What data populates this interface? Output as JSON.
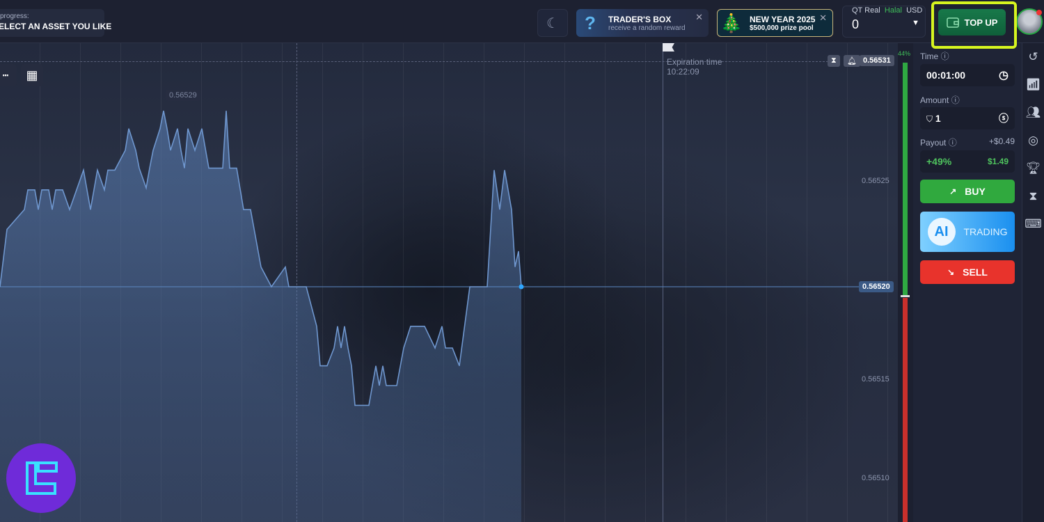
{
  "header": {
    "progress_label": "progress:",
    "progress_task": "ELECT AN ASSET YOU LIKE",
    "traders_box": {
      "title": "TRADER'S BOX",
      "subtitle": "receive a random reward"
    },
    "new_year": {
      "title": "NEW YEAR 2025",
      "subtitle": "$500,000 prize pool"
    },
    "account": {
      "type": "QT Real",
      "tag": "Halal",
      "currency": "USD",
      "balance": "0"
    },
    "topup_label": "TOP UP",
    "colors": {
      "accent_green": "#16713f",
      "highlight": "#d7f51f"
    }
  },
  "chart": {
    "expiration_label": "Expiration time",
    "expiration_time": "10:22:09",
    "current_price": "0.56520",
    "high_price_label": "0.56529",
    "alert_price": "0.56531",
    "y_ticks": [
      "0.56525",
      "0.56520",
      "0.56515",
      "0.56510"
    ],
    "buy_percent": "44%",
    "price_line": {
      "color": "#6f97cf",
      "points": [
        [
          0,
          0.5652
        ],
        [
          2,
          0.565229
        ],
        [
          7,
          0.565239
        ],
        [
          8,
          0.565249
        ],
        [
          10,
          0.565249
        ],
        [
          11,
          0.565239
        ],
        [
          12,
          0.565249
        ],
        [
          14,
          0.565249
        ],
        [
          15,
          0.565239
        ],
        [
          16,
          0.565249
        ],
        [
          18,
          0.565249
        ],
        [
          20,
          0.565239
        ],
        [
          22,
          0.565249
        ],
        [
          24,
          0.565259
        ],
        [
          26,
          0.565239
        ],
        [
          28,
          0.565259
        ],
        [
          30,
          0.565249
        ],
        [
          31,
          0.565259
        ],
        [
          33,
          0.565259
        ],
        [
          36,
          0.565269
        ],
        [
          37,
          0.56528
        ],
        [
          39,
          0.565269
        ],
        [
          40,
          0.56526
        ],
        [
          42,
          0.56525
        ],
        [
          43,
          0.56526
        ],
        [
          44,
          0.565269
        ],
        [
          46,
          0.56528
        ],
        [
          47,
          0.565289
        ],
        [
          48,
          0.56528
        ],
        [
          49,
          0.565269
        ],
        [
          51,
          0.56528
        ],
        [
          52,
          0.565269
        ],
        [
          53,
          0.56526
        ],
        [
          54,
          0.56528
        ],
        [
          56,
          0.565269
        ],
        [
          58,
          0.56528
        ],
        [
          60,
          0.56526
        ],
        [
          64,
          0.56526
        ],
        [
          65,
          0.565289
        ],
        [
          66,
          0.56526
        ],
        [
          68,
          0.56526
        ],
        [
          70,
          0.565239
        ],
        [
          72,
          0.565239
        ],
        [
          75,
          0.56521
        ],
        [
          78,
          0.5652
        ],
        [
          82,
          0.56521
        ],
        [
          83,
          0.5652
        ],
        [
          88,
          0.5652
        ],
        [
          91,
          0.56518
        ],
        [
          92,
          0.56516
        ],
        [
          94,
          0.56516
        ],
        [
          96,
          0.565169
        ],
        [
          97,
          0.56518
        ],
        [
          98,
          0.565169
        ],
        [
          99,
          0.56518
        ],
        [
          100,
          0.565169
        ],
        [
          101,
          0.56516
        ],
        [
          102,
          0.56514
        ],
        [
          106,
          0.56514
        ],
        [
          108,
          0.56516
        ],
        [
          109,
          0.56515
        ],
        [
          110,
          0.56516
        ],
        [
          111,
          0.56515
        ],
        [
          114,
          0.56515
        ],
        [
          116,
          0.565169
        ],
        [
          118,
          0.56518
        ],
        [
          122,
          0.56518
        ],
        [
          125,
          0.565169
        ],
        [
          127,
          0.56518
        ],
        [
          128,
          0.565169
        ],
        [
          130,
          0.565169
        ],
        [
          132,
          0.56516
        ],
        [
          135,
          0.5652
        ],
        [
          140,
          0.5652
        ],
        [
          142,
          0.565259
        ],
        [
          143.6,
          0.565239
        ],
        [
          145,
          0.565259
        ],
        [
          147,
          0.565239
        ],
        [
          148,
          0.56521
        ],
        [
          149,
          0.565218
        ],
        [
          149.8,
          0.5652
        ]
      ]
    }
  },
  "panel": {
    "time_label": "Time",
    "time_value": "00:01:00",
    "amount_label": "Amount",
    "amount_value": "1",
    "payout_label": "Payout",
    "payout_profit": "+$0.49",
    "payout_percent": "+49%",
    "payout_total": "$1.49",
    "buy_label": "BUY",
    "ai_label": "AI",
    "ai_trading_label": "TRADING",
    "sell_label": "SELL"
  },
  "sidebar_icons": [
    "history-icon",
    "signals-icon",
    "social-trading-icon",
    "target-icon",
    "trophy-icon",
    "hourglass-icon",
    "keyboard-icon"
  ]
}
